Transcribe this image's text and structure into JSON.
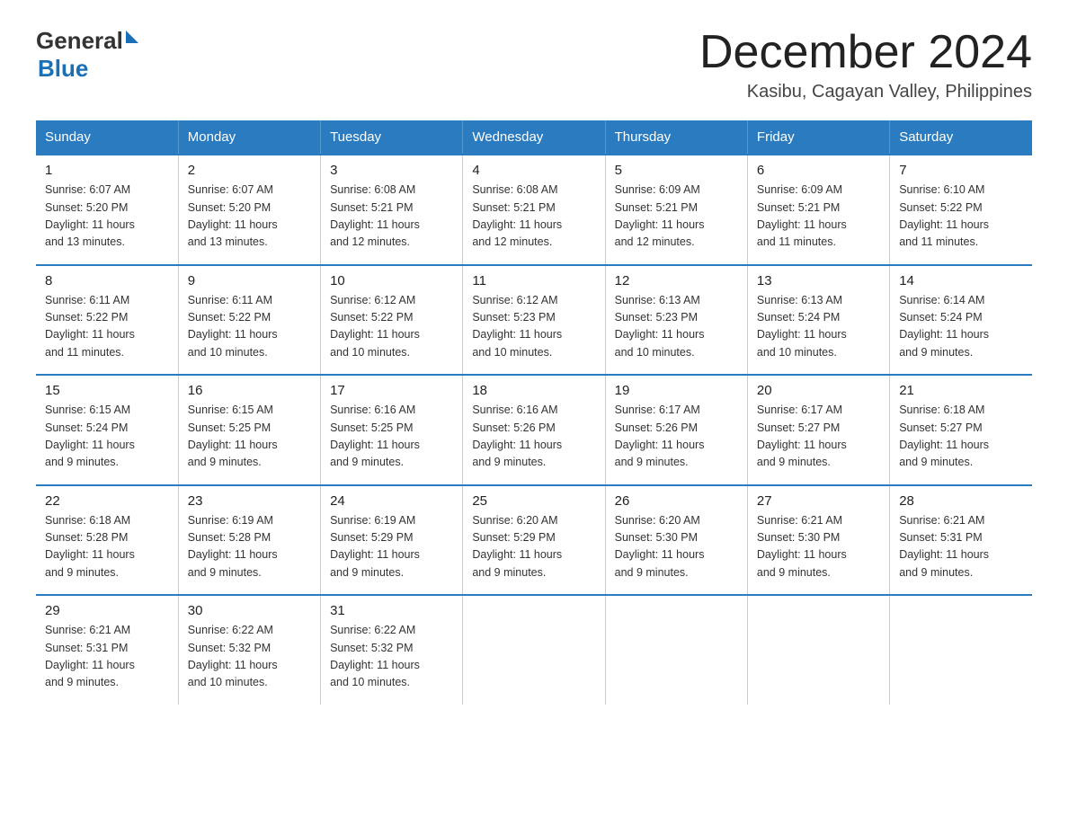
{
  "logo": {
    "general": "General",
    "triangle": "",
    "blue": "Blue"
  },
  "title": "December 2024",
  "subtitle": "Kasibu, Cagayan Valley, Philippines",
  "days_header": [
    "Sunday",
    "Monday",
    "Tuesday",
    "Wednesday",
    "Thursday",
    "Friday",
    "Saturday"
  ],
  "weeks": [
    [
      {
        "day": "1",
        "sunrise": "6:07 AM",
        "sunset": "5:20 PM",
        "daylight": "11 hours and 13 minutes."
      },
      {
        "day": "2",
        "sunrise": "6:07 AM",
        "sunset": "5:20 PM",
        "daylight": "11 hours and 13 minutes."
      },
      {
        "day": "3",
        "sunrise": "6:08 AM",
        "sunset": "5:21 PM",
        "daylight": "11 hours and 12 minutes."
      },
      {
        "day": "4",
        "sunrise": "6:08 AM",
        "sunset": "5:21 PM",
        "daylight": "11 hours and 12 minutes."
      },
      {
        "day": "5",
        "sunrise": "6:09 AM",
        "sunset": "5:21 PM",
        "daylight": "11 hours and 12 minutes."
      },
      {
        "day": "6",
        "sunrise": "6:09 AM",
        "sunset": "5:21 PM",
        "daylight": "11 hours and 11 minutes."
      },
      {
        "day": "7",
        "sunrise": "6:10 AM",
        "sunset": "5:22 PM",
        "daylight": "11 hours and 11 minutes."
      }
    ],
    [
      {
        "day": "8",
        "sunrise": "6:11 AM",
        "sunset": "5:22 PM",
        "daylight": "11 hours and 11 minutes."
      },
      {
        "day": "9",
        "sunrise": "6:11 AM",
        "sunset": "5:22 PM",
        "daylight": "11 hours and 10 minutes."
      },
      {
        "day": "10",
        "sunrise": "6:12 AM",
        "sunset": "5:22 PM",
        "daylight": "11 hours and 10 minutes."
      },
      {
        "day": "11",
        "sunrise": "6:12 AM",
        "sunset": "5:23 PM",
        "daylight": "11 hours and 10 minutes."
      },
      {
        "day": "12",
        "sunrise": "6:13 AM",
        "sunset": "5:23 PM",
        "daylight": "11 hours and 10 minutes."
      },
      {
        "day": "13",
        "sunrise": "6:13 AM",
        "sunset": "5:24 PM",
        "daylight": "11 hours and 10 minutes."
      },
      {
        "day": "14",
        "sunrise": "6:14 AM",
        "sunset": "5:24 PM",
        "daylight": "11 hours and 9 minutes."
      }
    ],
    [
      {
        "day": "15",
        "sunrise": "6:15 AM",
        "sunset": "5:24 PM",
        "daylight": "11 hours and 9 minutes."
      },
      {
        "day": "16",
        "sunrise": "6:15 AM",
        "sunset": "5:25 PM",
        "daylight": "11 hours and 9 minutes."
      },
      {
        "day": "17",
        "sunrise": "6:16 AM",
        "sunset": "5:25 PM",
        "daylight": "11 hours and 9 minutes."
      },
      {
        "day": "18",
        "sunrise": "6:16 AM",
        "sunset": "5:26 PM",
        "daylight": "11 hours and 9 minutes."
      },
      {
        "day": "19",
        "sunrise": "6:17 AM",
        "sunset": "5:26 PM",
        "daylight": "11 hours and 9 minutes."
      },
      {
        "day": "20",
        "sunrise": "6:17 AM",
        "sunset": "5:27 PM",
        "daylight": "11 hours and 9 minutes."
      },
      {
        "day": "21",
        "sunrise": "6:18 AM",
        "sunset": "5:27 PM",
        "daylight": "11 hours and 9 minutes."
      }
    ],
    [
      {
        "day": "22",
        "sunrise": "6:18 AM",
        "sunset": "5:28 PM",
        "daylight": "11 hours and 9 minutes."
      },
      {
        "day": "23",
        "sunrise": "6:19 AM",
        "sunset": "5:28 PM",
        "daylight": "11 hours and 9 minutes."
      },
      {
        "day": "24",
        "sunrise": "6:19 AM",
        "sunset": "5:29 PM",
        "daylight": "11 hours and 9 minutes."
      },
      {
        "day": "25",
        "sunrise": "6:20 AM",
        "sunset": "5:29 PM",
        "daylight": "11 hours and 9 minutes."
      },
      {
        "day": "26",
        "sunrise": "6:20 AM",
        "sunset": "5:30 PM",
        "daylight": "11 hours and 9 minutes."
      },
      {
        "day": "27",
        "sunrise": "6:21 AM",
        "sunset": "5:30 PM",
        "daylight": "11 hours and 9 minutes."
      },
      {
        "day": "28",
        "sunrise": "6:21 AM",
        "sunset": "5:31 PM",
        "daylight": "11 hours and 9 minutes."
      }
    ],
    [
      {
        "day": "29",
        "sunrise": "6:21 AM",
        "sunset": "5:31 PM",
        "daylight": "11 hours and 9 minutes."
      },
      {
        "day": "30",
        "sunrise": "6:22 AM",
        "sunset": "5:32 PM",
        "daylight": "11 hours and 10 minutes."
      },
      {
        "day": "31",
        "sunrise": "6:22 AM",
        "sunset": "5:32 PM",
        "daylight": "11 hours and 10 minutes."
      },
      null,
      null,
      null,
      null
    ]
  ],
  "labels": {
    "sunrise": "Sunrise:",
    "sunset": "Sunset:",
    "daylight": "Daylight:"
  }
}
